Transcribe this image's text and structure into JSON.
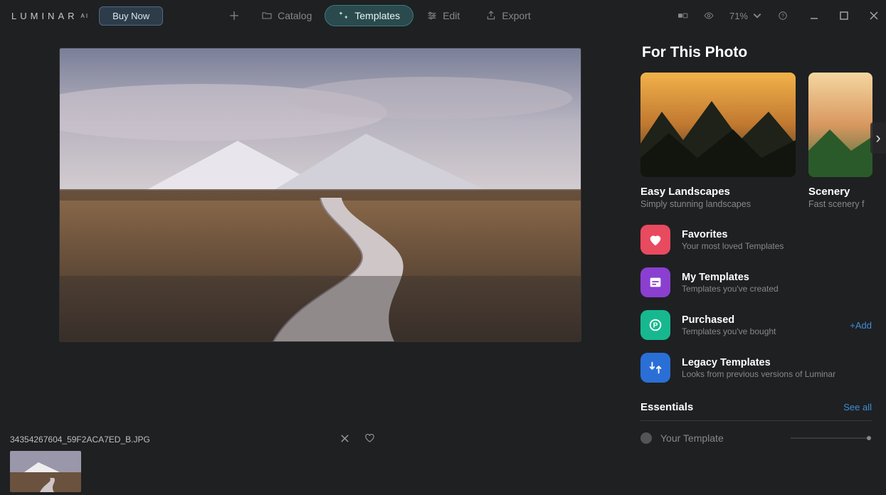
{
  "app": {
    "logo_main": "LUMINAR",
    "logo_sup": "AI"
  },
  "topbar": {
    "buy": "Buy Now",
    "nav": {
      "catalog": "Catalog",
      "templates": "Templates",
      "edit": "Edit",
      "export": "Export"
    },
    "zoom": "71%"
  },
  "file": {
    "name": "34354267604_59F2ACA7ED_B.JPG"
  },
  "panel": {
    "for_this_photo": "For This Photo",
    "cards": [
      {
        "title": "Easy Landscapes",
        "sub": "Simply stunning landscapes"
      },
      {
        "title": "Scenery",
        "sub": "Fast scenery f"
      }
    ],
    "list": {
      "favorites": {
        "title": "Favorites",
        "sub": "Your most loved Templates"
      },
      "mytpl": {
        "title": "My Templates",
        "sub": "Templates you've created"
      },
      "purchased": {
        "title": "Purchased",
        "sub": "Templates you've bought",
        "add": "+Add"
      },
      "legacy": {
        "title": "Legacy Templates",
        "sub": "Looks from previous versions of Luminar"
      }
    },
    "essentials": {
      "title": "Essentials",
      "see_all": "See all"
    },
    "your_template": "Your Template"
  },
  "colors": {
    "favorites": "#e84a5f",
    "mytpl": "#8a3fd1",
    "purchased": "#17b890",
    "legacy": "#2a6fd6"
  }
}
